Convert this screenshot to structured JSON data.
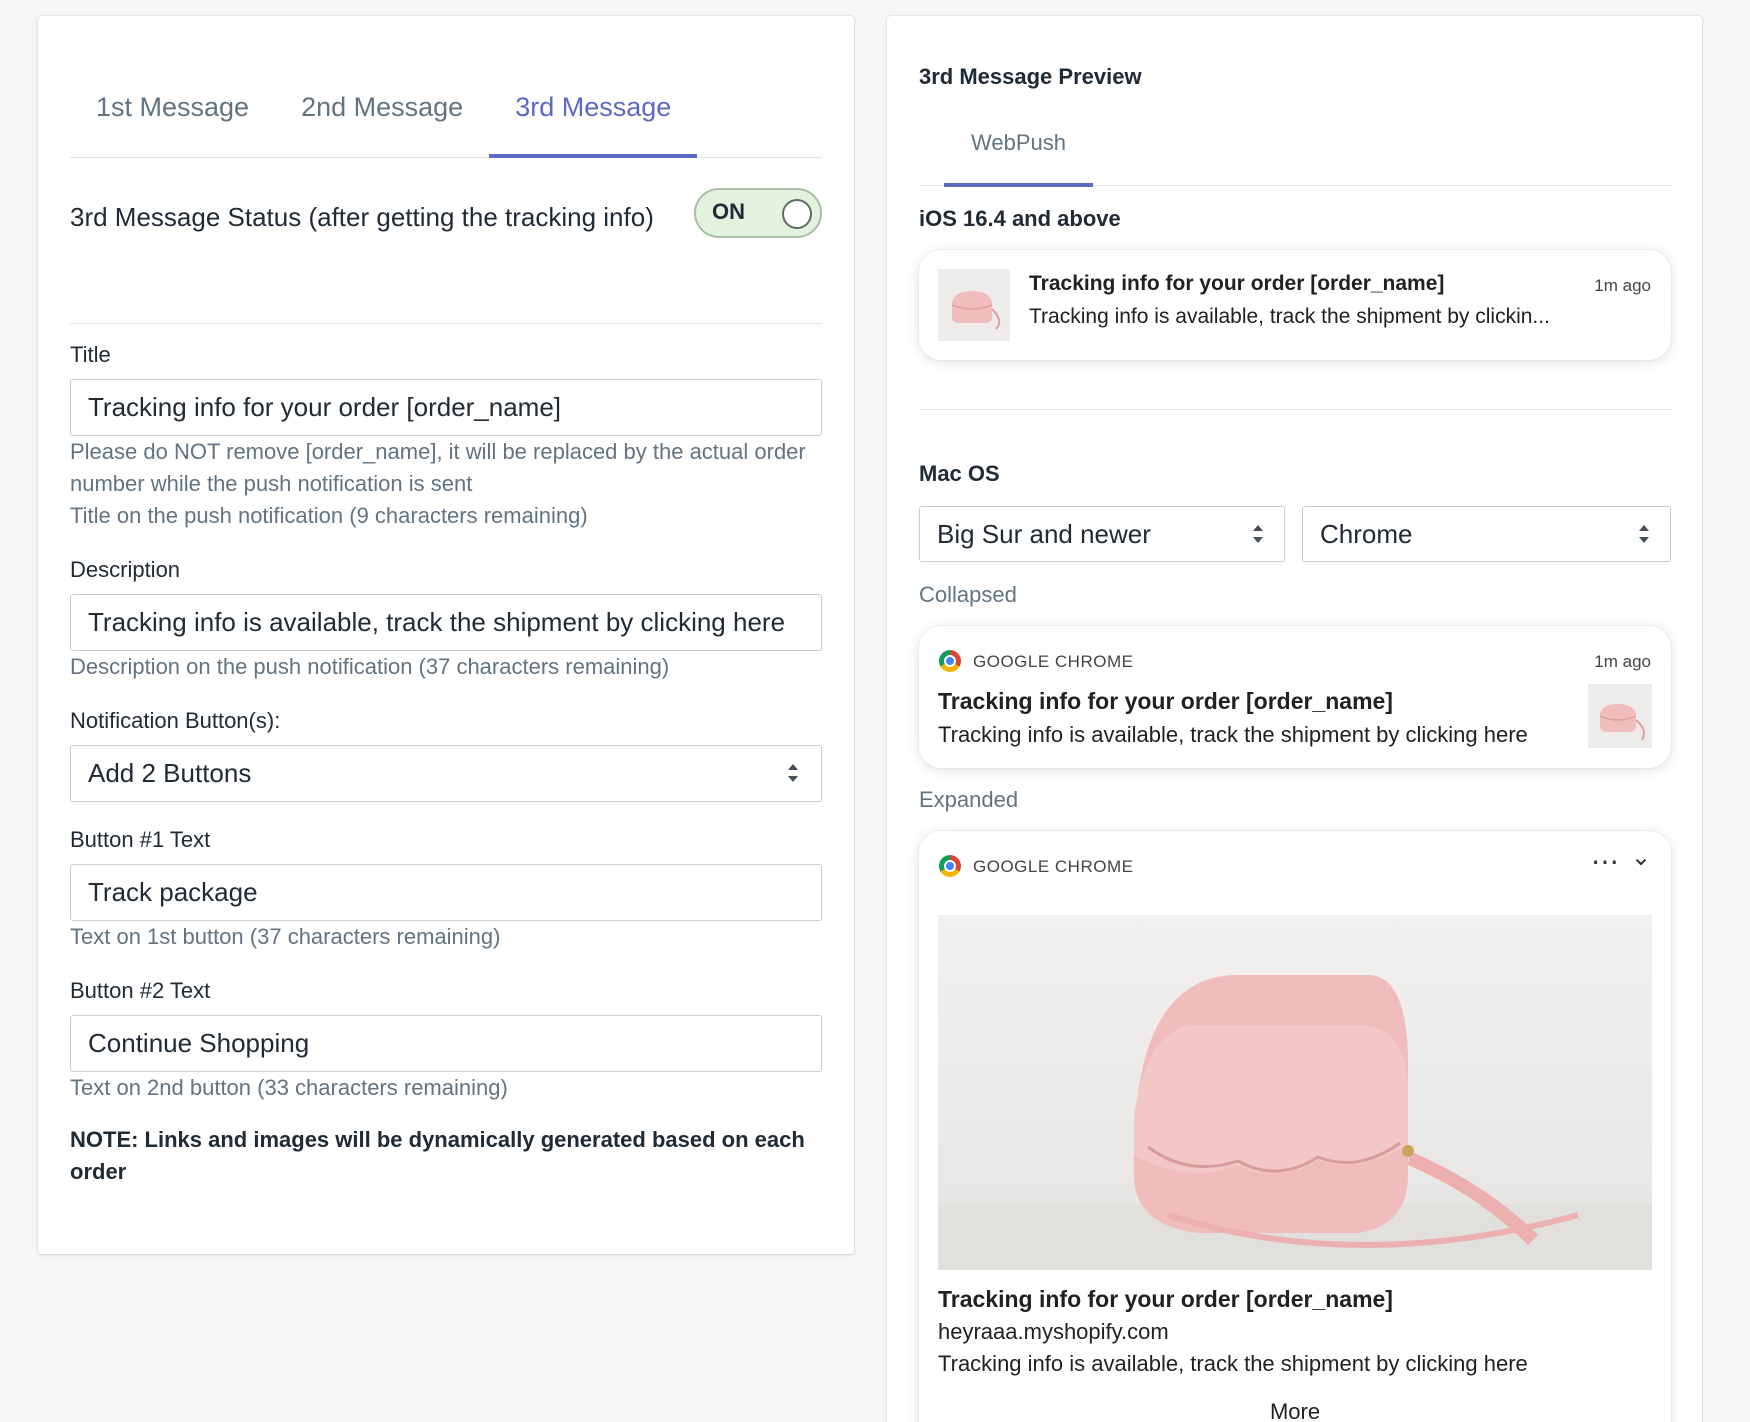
{
  "tabs": [
    {
      "label": "1st Message",
      "active": false
    },
    {
      "label": "2nd Message",
      "active": false
    },
    {
      "label": "3rd Message",
      "active": true
    }
  ],
  "status": {
    "title": "3rd Message Status (after getting the tracking info)",
    "toggle_label": "ON",
    "toggle_on": true
  },
  "title_field": {
    "label": "Title",
    "value": "Tracking info for your order [order_name]",
    "help_1": "Please do NOT remove [order_name], it will be replaced by the actual order number while the push notification is sent",
    "help_2": "Title on the push notification (9 characters remaining)"
  },
  "description_field": {
    "label": "Description",
    "value": "Tracking info is available, track the shipment by clicking here",
    "help": "Description on the push notification (37 characters remaining)"
  },
  "buttons_select": {
    "label": "Notification Button(s):",
    "value": "Add 2 Buttons"
  },
  "button1_field": {
    "label": "Button #1 Text",
    "value": "Track package",
    "help": "Text on 1st button (37 characters remaining)"
  },
  "button2_field": {
    "label": "Button #2 Text",
    "value": "Continue Shopping",
    "help": "Text on 2nd button (33 characters remaining)"
  },
  "note": "NOTE: Links and images will be dynamically generated based on each order",
  "preview": {
    "title": "3rd Message Preview",
    "tab": "WebPush",
    "ios": {
      "heading": "iOS 16.4 and above",
      "title": "Tracking info for your order [order_name]",
      "body": "Tracking info is available, track the shipment by clickin...",
      "time": "1m ago"
    },
    "mac": {
      "heading": "Mac OS",
      "os_select": "Big Sur and newer",
      "browser_select": "Chrome",
      "collapsed_label": "Collapsed",
      "expanded_label": "Expanded",
      "app_name": "GOOGLE CHROME",
      "time": "1m ago",
      "title": "Tracking info for your order [order_name]",
      "body": "Tracking info is available, track the shipment by clicking here",
      "domain": "heyraaa.myshopify.com",
      "more": "More",
      "menu_glyph": "⋯",
      "chevron_glyph": "⌄"
    }
  },
  "colors": {
    "accent": "#5c6ac4",
    "toggle_bg": "#e3f1df",
    "bag_pink": "#f0bcbc"
  }
}
